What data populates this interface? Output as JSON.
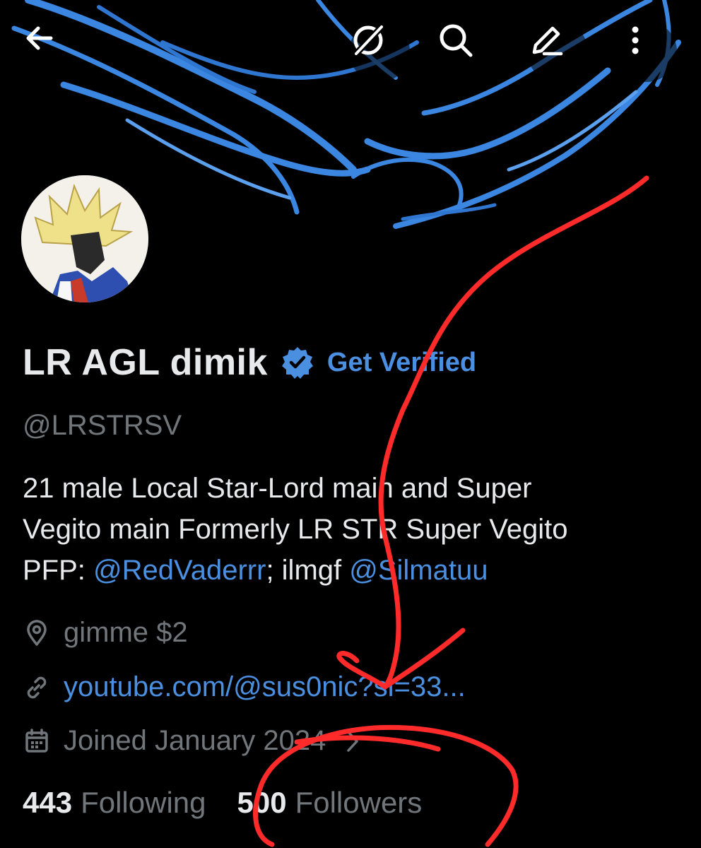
{
  "header": {
    "back_icon": "arrow-left-icon",
    "grok_icon": "grok-icon",
    "search_icon": "search-icon",
    "compose_icon": "pencil-icon",
    "more_icon": "more-vertical-icon"
  },
  "profile": {
    "display_name": "LR AGL dimik",
    "verified_badge_icon": "verified-badge-icon",
    "get_verified_label": "Get Verified",
    "handle": "@LRSTRSV",
    "bio": {
      "line1": "21 male Local Star-Lord main and Super",
      "line2": "Vegito main Formerly LR STR Super Vegito",
      "line3_prefix": "PFP: ",
      "mention1": "@RedVaderrr",
      "line3_middle": "; ilmgf ",
      "mention2": "@Silmatuu"
    },
    "location": "gimme $2",
    "link": "youtube.com/@sus0nic?si=33...",
    "joined": "Joined January 2024"
  },
  "stats": {
    "following_count": "443",
    "following_label": "Following",
    "followers_count": "500",
    "followers_label": "Followers"
  },
  "colors": {
    "background": "#000000",
    "text_primary": "#e7e9ea",
    "text_secondary": "#71767b",
    "link_blue": "#4a8fe0",
    "banner_blue": "#3a86e0",
    "annotation_red": "#ff2a2a"
  }
}
